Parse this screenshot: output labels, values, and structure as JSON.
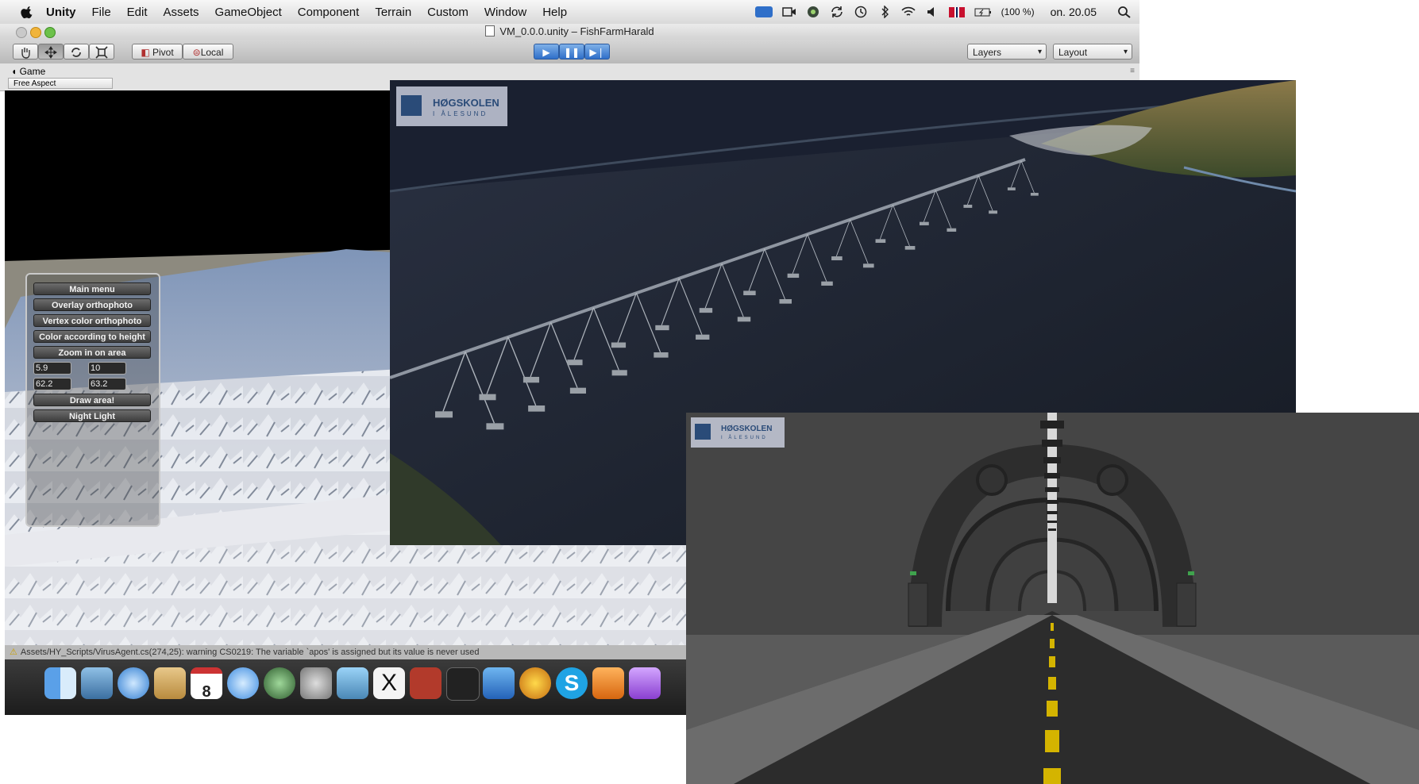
{
  "menubar": {
    "app_name": "Unity",
    "items": [
      "File",
      "Edit",
      "Assets",
      "GameObject",
      "Component",
      "Terrain",
      "Custom",
      "Window",
      "Help"
    ],
    "battery": "(100 %)",
    "clock": "on. 20.05"
  },
  "window": {
    "title": "VM_0.0.0.unity – FishFarmHarald"
  },
  "toolbar": {
    "pivot": "Pivot",
    "local": "Local",
    "layers": "Layers",
    "layout": "Layout"
  },
  "game_tab": {
    "title": "Game",
    "aspect": "Free Aspect"
  },
  "menu_panel": {
    "buttons": [
      "Main menu",
      "Overlay orthophoto",
      "Vertex color orthophoto",
      "Color according to height",
      "Zoom in on area"
    ],
    "fields": [
      "5.9",
      "10",
      "62.2",
      "63.2"
    ],
    "draw_button": "Draw area!",
    "light_button": "Night Light"
  },
  "console": {
    "warning": "Assets/HY_Scripts/VirusAgent.cs(274,25): warning CS0219: The variable `apos' is assigned but its value is never used"
  },
  "logo": {
    "name": "HØGSKOLEN",
    "place": "I ÅLESUND"
  },
  "dock": {
    "calendar_day": "8",
    "icons": [
      "finder-icon",
      "preview-icon",
      "safari-icon",
      "mail-icon",
      "calendar-icon",
      "itunes-icon",
      "time-machine-icon",
      "system-preferences-icon",
      "iphoto-icon",
      "x11-icon",
      "mendeley-icon",
      "unity-icon",
      "word-icon",
      "bird-icon",
      "skype-icon",
      "powerpoint-icon",
      "ie-icon"
    ]
  },
  "colors": {
    "accent_blue": "#2f6fc9",
    "logo_blue": "#2a4b78",
    "road_line_yellow": "#d4b400"
  }
}
